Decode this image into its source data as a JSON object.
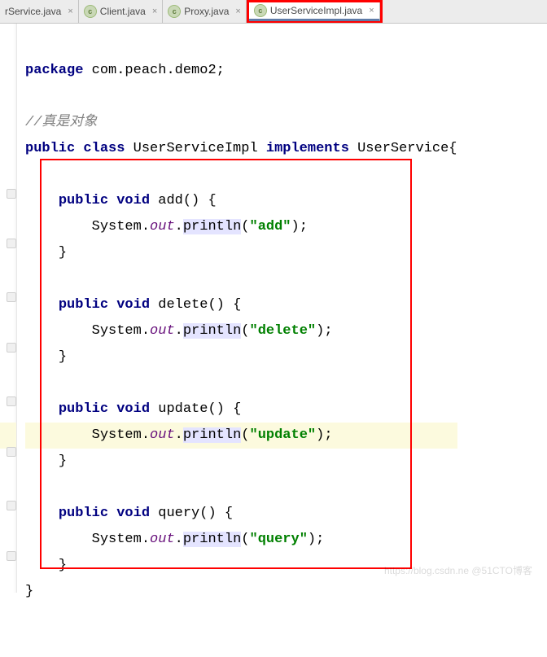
{
  "tabs": {
    "t0": {
      "label": "rService.java"
    },
    "t1": {
      "label": "Client.java"
    },
    "t2": {
      "label": "Proxy.java"
    },
    "t3": {
      "label": "UserServiceImpl.java"
    }
  },
  "code": {
    "pkg_kw": "package ",
    "pkg_name": "com.peach.demo2",
    "semi": ";",
    "comment": "//真是对象",
    "public": "public ",
    "class": "class ",
    "class_name": "UserServiceImpl ",
    "implements": "implements ",
    "iface": "UserService{",
    "void": "void ",
    "m_add": "add",
    "m_delete": "delete",
    "m_update": "update",
    "m_query": "query",
    "paren_open_brace": "() {",
    "close_brace": "}",
    "indent1": "    ",
    "indent2": "        ",
    "sys": "System.",
    "out": "out",
    "dot": ".",
    "println": "println",
    "popen": "(",
    "pclose": ")",
    "quote": "\"",
    "str_add": "add",
    "str_delete": "delete",
    "str_update": "update",
    "str_query": "query"
  },
  "watermark": "https://blog.csdn.ne @51CTO博客"
}
